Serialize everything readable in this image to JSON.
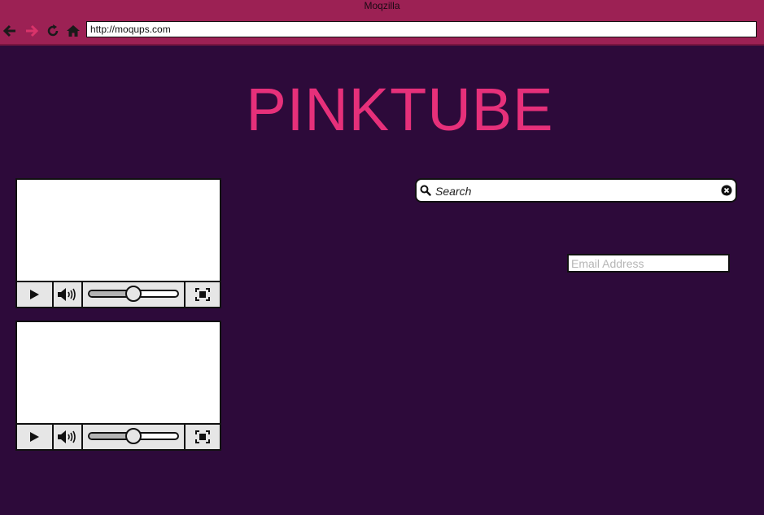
{
  "window": {
    "title": "Moqzilla"
  },
  "toolbar": {
    "url": "http://moqups.com"
  },
  "icons": {
    "back": "arrow-left-icon",
    "forward": "arrow-right-icon",
    "reload": "reload-icon",
    "home": "home-icon"
  },
  "page": {
    "logo": "PINKTUBE",
    "search": {
      "placeholder": "Search"
    },
    "email": {
      "placeholder": "Email Address"
    }
  },
  "videos": [
    {
      "seek_position": 0.5
    },
    {
      "seek_position": 0.5
    }
  ],
  "colors": {
    "titlebar": "#9c2154",
    "background": "#2d0a3a",
    "accent": "#e6307a",
    "forward_disabled": "#d9336a"
  }
}
